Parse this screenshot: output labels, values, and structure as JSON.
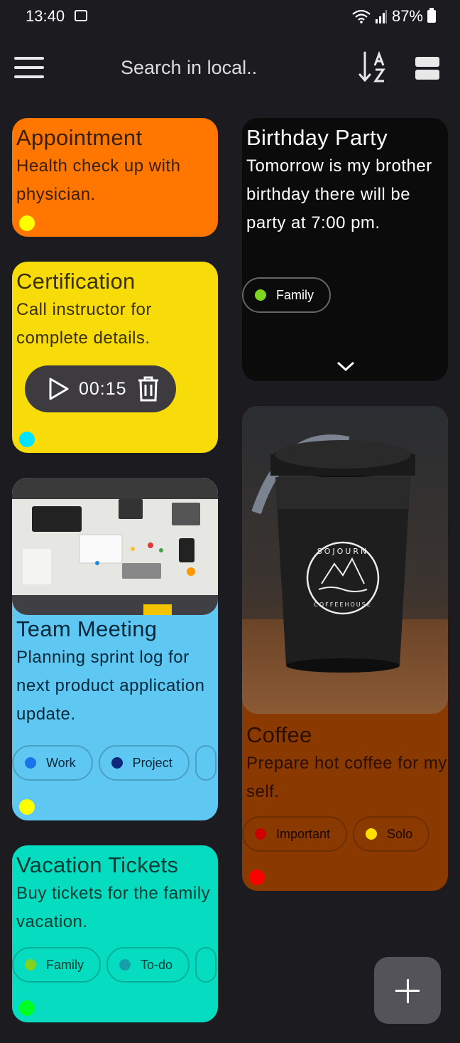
{
  "status": {
    "time": "13:40",
    "battery": "87%"
  },
  "search": {
    "placeholder": "Search in local.."
  },
  "notes": {
    "appointment": {
      "title": "Appointment",
      "body": "Health check up with physician.",
      "dot": "#ffff00",
      "color": "#ff7700"
    },
    "certification": {
      "title": "Certification",
      "body": "Call instructor for complete details.",
      "dot": "#00e5ff",
      "color": "#f8dc0a",
      "audio_time": "00:15"
    },
    "team_meeting": {
      "title": "Team Meeting",
      "body": "Planning sprint log for next product application update.",
      "dot": "#ffff00",
      "color": "#5fc8f2",
      "chips": [
        {
          "label": "Work",
          "color": "#1a73e8"
        },
        {
          "label": "Project",
          "color": "#0d2a7a"
        }
      ]
    },
    "vacation": {
      "title": "Vacation Tickets",
      "body": "Buy tickets for the family vacation.",
      "dot": "#00ff22",
      "color": "#06ddc0",
      "chips": [
        {
          "label": "Family",
          "color": "#7fd321"
        },
        {
          "label": "To-do",
          "color": "#169fa8"
        }
      ]
    },
    "birthday": {
      "title": "Birthday Party",
      "body": "Tomorrow is my brother birthday there will be party at 7:00 pm.",
      "color": "#0b0b0b",
      "chips": [
        {
          "label": "Family",
          "color": "#7fd321"
        }
      ]
    },
    "coffee": {
      "title": "Coffee",
      "body": "Prepare hot coffee for my self.",
      "dot": "#ff0000",
      "color": "#8a3a00",
      "chips": [
        {
          "label": "Important",
          "color": "#cc0000"
        },
        {
          "label": "Solo",
          "color": "#ffe000"
        }
      ]
    }
  },
  "images": {
    "coffee_logo_line1": "SOJOURN",
    "coffee_logo_line2": "COFFEEHOUSE"
  }
}
